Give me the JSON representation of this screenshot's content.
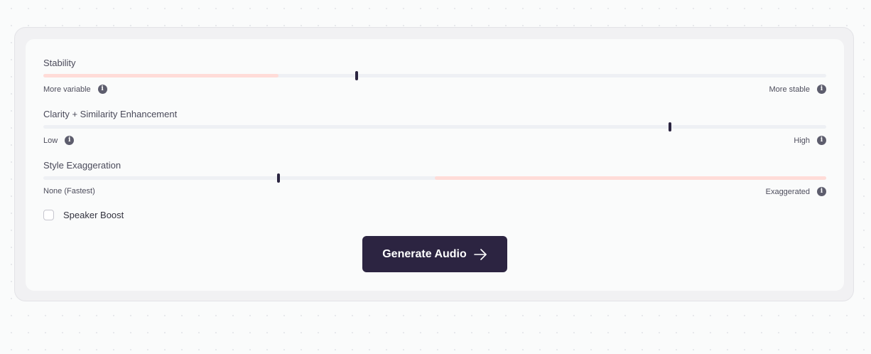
{
  "sliders": [
    {
      "label": "Stability",
      "left_label": "More variable",
      "right_label": "More stable",
      "left_info": true,
      "right_info": true,
      "value_fraction": 0.4,
      "highlight_from": 0.0,
      "highlight_to": 0.3
    },
    {
      "label": "Clarity + Similarity Enhancement",
      "left_label": "Low",
      "right_label": "High",
      "left_info": true,
      "right_info": true,
      "value_fraction": 0.8,
      "highlight_from": null,
      "highlight_to": null
    },
    {
      "label": "Style Exaggeration",
      "left_label": "None (Fastest)",
      "right_label": "Exaggerated",
      "left_info": false,
      "right_info": true,
      "value_fraction": 0.3,
      "highlight_from": 0.5,
      "highlight_to": 1.0
    }
  ],
  "speaker_boost": {
    "label": "Speaker Boost",
    "checked": false
  },
  "generate_button": {
    "label": "Generate Audio",
    "icon": "arrow-right-icon"
  },
  "icons": {
    "info": "info-icon",
    "info_glyph": "i"
  },
  "colors": {
    "button_bg": "#2c2441",
    "thumb": "#2b2540",
    "track": "#eef0f4",
    "track_highlight": "#ffdcd8"
  }
}
